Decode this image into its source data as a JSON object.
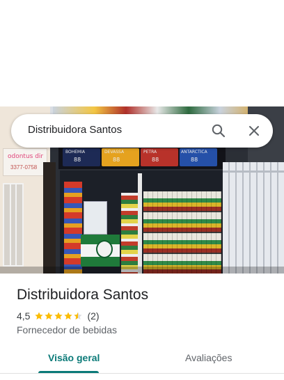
{
  "search": {
    "query": "Distribuidora Santos",
    "search_icon": "search-icon",
    "close_icon": "close-icon"
  },
  "photo": {
    "left_sign_text": "odontus dir",
    "left_sign_phone": "3377-0758",
    "brands": [
      "BOHEMIA",
      "DEVASSA",
      "PETRA",
      "ANTARCTICA"
    ],
    "brand_price": "88"
  },
  "place": {
    "name": "Distribuidora Santos",
    "rating": "4,5",
    "rating_value": 4.5,
    "rating_max": 5,
    "review_count": "(2)",
    "category": "Fornecedor de bebidas"
  },
  "tabs": [
    {
      "label": "Visão geral",
      "selected": true
    },
    {
      "label": "Avaliações",
      "selected": false
    }
  ],
  "colors": {
    "accent": "#0b7a78",
    "star": "#fbbc04"
  }
}
